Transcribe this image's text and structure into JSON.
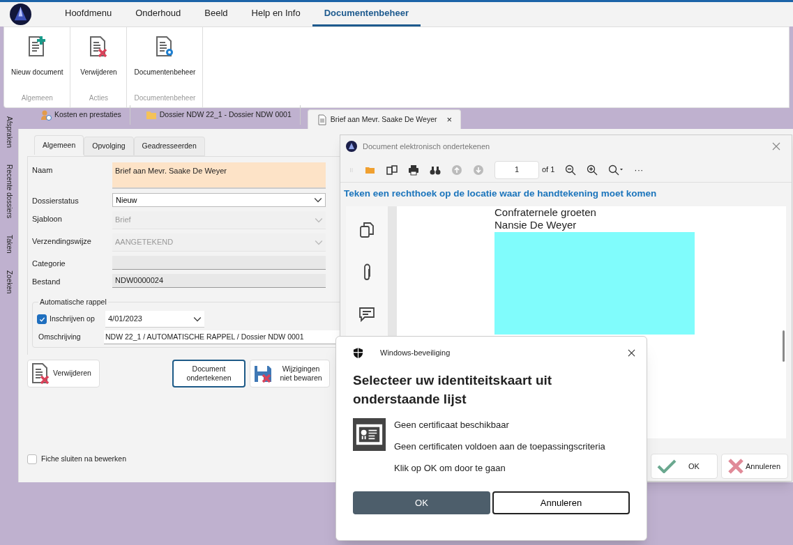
{
  "menu_tabs": [
    {
      "label": "Hoofdmenu",
      "selected": false
    },
    {
      "label": "Onderhoud",
      "selected": false
    },
    {
      "label": "Beeld",
      "selected": false
    },
    {
      "label": "Help en Info",
      "selected": false
    },
    {
      "label": "Documentenbeheer",
      "selected": true
    }
  ],
  "ribbon_groups": [
    {
      "label": "Algemeen",
      "buttons": [
        {
          "label": "Nieuw document",
          "kind": "new"
        }
      ]
    },
    {
      "label": "Acties",
      "buttons": [
        {
          "label": "Verwijderen",
          "kind": "delete"
        }
      ]
    },
    {
      "label": "Documentenbeheer",
      "buttons": [
        {
          "label": "Documentenbeheer",
          "kind": "manage"
        }
      ]
    }
  ],
  "side_tabs": [
    "Afspraken",
    "Recente dossiers",
    "Taken",
    "Zoeken"
  ],
  "doc_tabs": [
    {
      "label": "Kosten en prestaties",
      "kind": "person",
      "selected": false
    },
    {
      "label": "Dossier NDW 22_1 - Dossier NDW 0001",
      "kind": "folder",
      "selected": false
    },
    {
      "label": "Brief aan Mevr. Saake De Weyer",
      "kind": "document",
      "selected": true,
      "close": "×"
    }
  ],
  "form": {
    "tabs": [
      {
        "label": "Algemeen",
        "selected": true
      },
      {
        "label": "Opvolging",
        "selected": false
      },
      {
        "label": "Geadresseerden",
        "selected": false
      }
    ],
    "fields": [
      {
        "label": "Naam",
        "kind": "textarea",
        "value": "Brief aan Mevr. Saake De Weyer"
      },
      {
        "label": "Dossierstatus",
        "kind": "select",
        "value": "Nieuw",
        "disabled": false
      },
      {
        "label": "Sjabloon",
        "kind": "select",
        "value": "Brief",
        "disabled": true
      },
      {
        "label": "Verzendingswijze",
        "kind": "select",
        "value": "AANGETEKEND",
        "disabled": true
      },
      {
        "label": "Categorie",
        "kind": "text",
        "disabled": true
      },
      {
        "label": "Bestand",
        "kind": "text",
        "value": "NDW0000024",
        "disabled": true
      }
    ],
    "reminder": {
      "legend": "Automatische rappel",
      "register": {
        "label": "Inschrijven op",
        "checked": true
      },
      "date": "4/01/2023",
      "description_label": "Omschrijving",
      "description": "NDW 22_1 / AUTOMATISCHE RAPPEL / Dossier NDW 0001"
    },
    "buttons": [
      {
        "label": "Verwijderen",
        "kind": "delete",
        "focused": false
      },
      {
        "label": "Document ondertekenen",
        "kind": "plain",
        "focused": true
      },
      {
        "label": "Wijzigingen niet bewaren",
        "kind": "discard",
        "focused": false
      }
    ],
    "close_after_edit": {
      "label": "Fiche sluiten na bewerken",
      "checked": false
    }
  },
  "sign_dialog": {
    "title": "Document elektronisch ondertekenen",
    "page": "1",
    "page_count": "of 1",
    "more": "···",
    "instruction": "Teken een rechthoek op de locatie waar de handtekening moet komen",
    "page_lines": [
      "Confraternele groeten",
      "Nansie De Weyer"
    ],
    "buttons": [
      {
        "label": "OK",
        "kind": "ok"
      },
      {
        "label": "Annuleren",
        "kind": "cancel"
      }
    ]
  },
  "security_dialog": {
    "title": "Windows-beveiliging",
    "heading": "Selecteer uw identiteitskaart uit onderstaande lijst",
    "lines": [
      "Geen certificaat beschikbaar",
      "Geen certificaten voldoen aan de toepassingscriteria",
      "Klik op OK om door te gaan"
    ],
    "buttons": [
      {
        "label": "OK",
        "primary": true
      },
      {
        "label": "Annuleren",
        "primary": false
      }
    ]
  }
}
